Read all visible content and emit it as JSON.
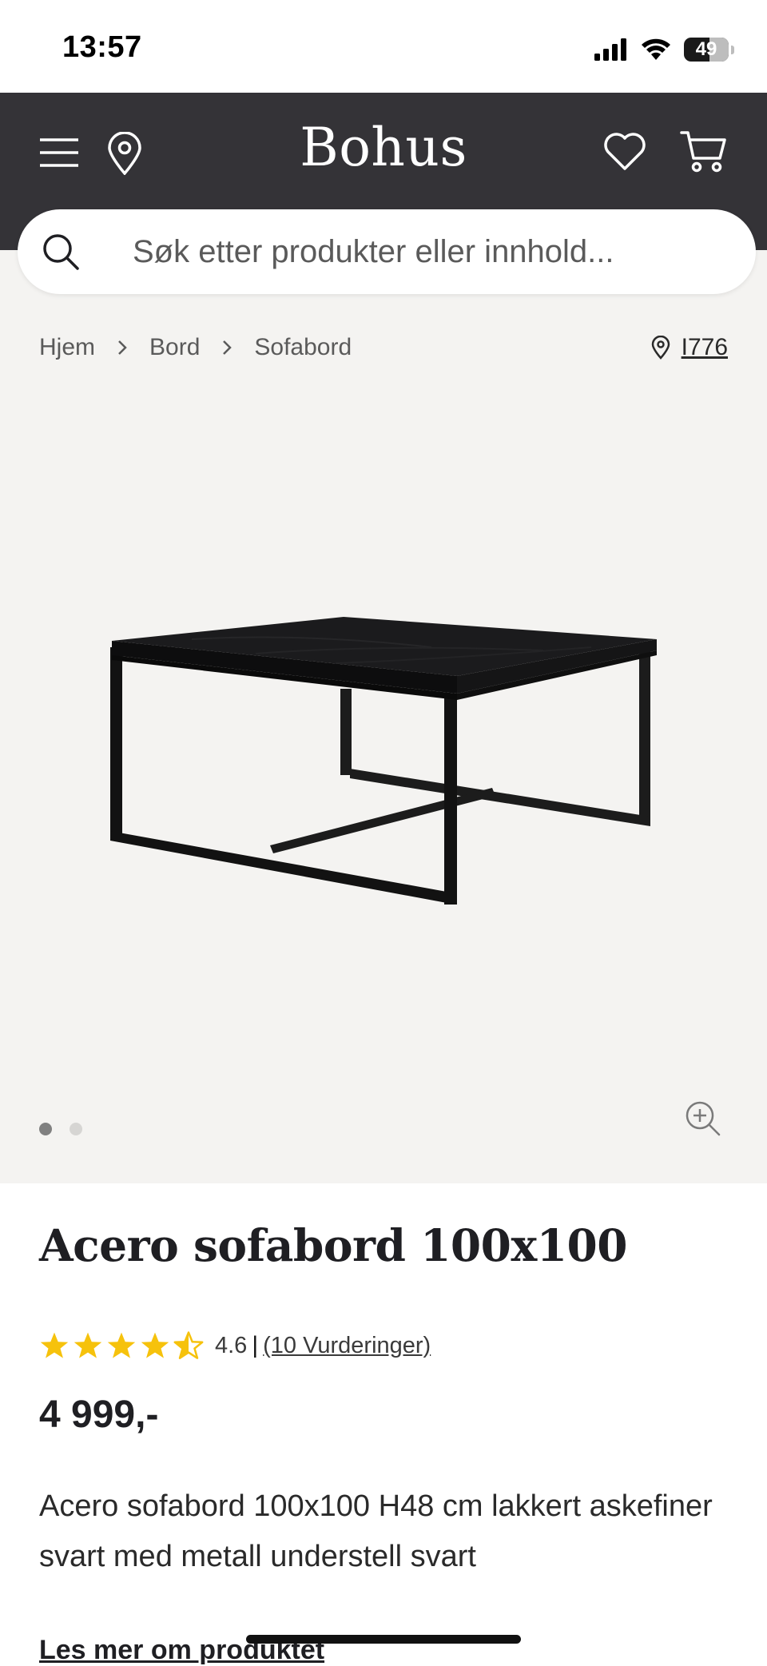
{
  "status_bar": {
    "time": "13:57",
    "battery": "49"
  },
  "header": {
    "logo": "Bohus"
  },
  "search": {
    "placeholder": "Søk etter produkter eller innhold..."
  },
  "breadcrumb": [
    "Hjem",
    "Bord",
    "Sofabord"
  ],
  "store": {
    "label": "I776"
  },
  "gallery": {
    "slide_count": 2,
    "active_index": 0
  },
  "product": {
    "title": "Acero sofabord 100x100",
    "rating": 4.6,
    "rating_text": "4.6",
    "rating_separator": "|",
    "reviews_link": "(10 Vurderinger)",
    "price": "4 999,-",
    "description": "Acero sofabord 100x100 H48 cm lakkert askefiner svart med metall understell svart",
    "read_more": "Les mer om produktet"
  },
  "colors": {
    "header_bg": "#343337",
    "gallery_bg": "#f4f3f1",
    "star": "#f6c20c",
    "text": "#1f1f23"
  }
}
